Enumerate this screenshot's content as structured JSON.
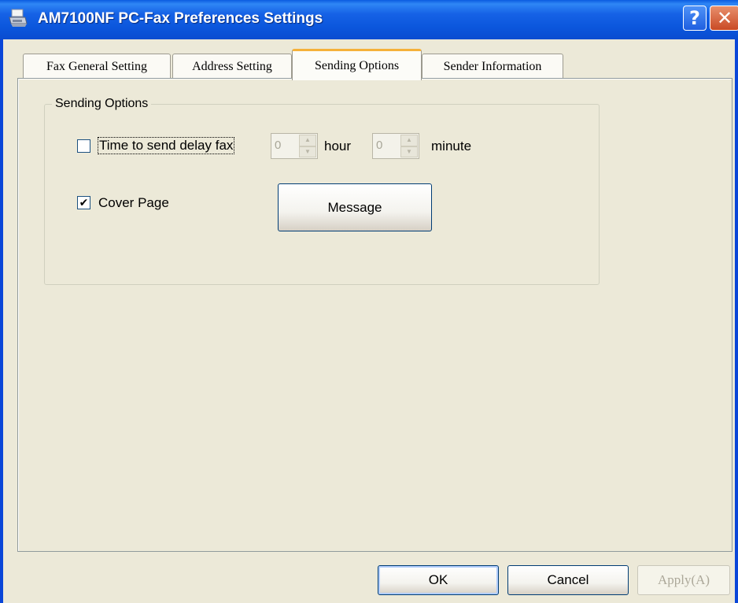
{
  "window": {
    "title": "AM7100NF PC-Fax Preferences Settings",
    "help_glyph": "?",
    "close_glyph": "✕"
  },
  "tabs": [
    {
      "label": "Fax General Setting",
      "active": false
    },
    {
      "label": "Address Setting",
      "active": false
    },
    {
      "label": "Sending Options",
      "active": true
    },
    {
      "label": "Sender Information",
      "active": false
    }
  ],
  "sending_options": {
    "group_title": "Sending Options",
    "delay_fax": {
      "label": "Time to send delay fax",
      "checked": false,
      "hour_value": "0",
      "hour_unit": "hour",
      "minute_value": "0",
      "minute_unit": "minute"
    },
    "cover_page": {
      "label": "Cover Page",
      "checked": true,
      "check_glyph": "✔"
    },
    "message_button": "Message"
  },
  "footer": {
    "ok": "OK",
    "cancel": "Cancel",
    "apply": "Apply(A)"
  },
  "icons": {
    "title": "printer-fax-icon",
    "help": "help-icon",
    "close": "close-icon"
  },
  "colors": {
    "titlebar": "#0b56dc",
    "dialog_bg": "#ece9d8",
    "active_tab_accent": "#f5b13a",
    "close_button": "#c94a25"
  }
}
